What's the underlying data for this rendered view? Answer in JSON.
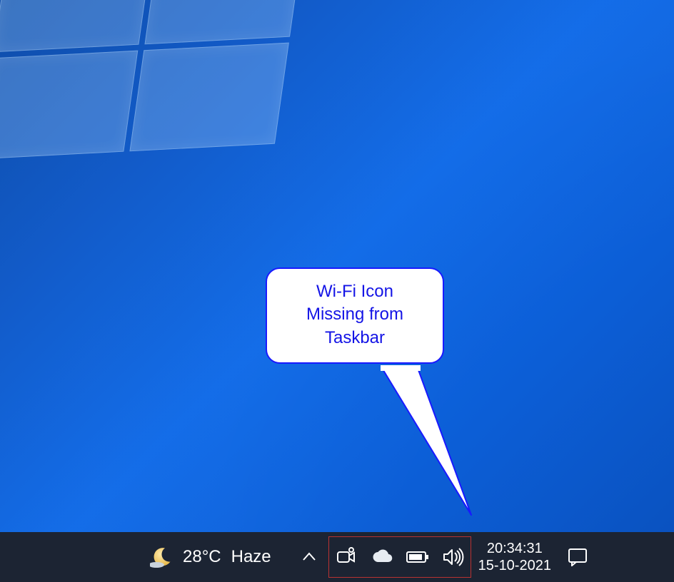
{
  "callout": {
    "line1": "Wi-Fi Icon",
    "line2": "Missing from",
    "line3": "Taskbar"
  },
  "weather": {
    "temp": "28°C",
    "condition": "Haze"
  },
  "datetime": {
    "time": "20:34:31",
    "date": "15-10-2021"
  },
  "colors": {
    "callout_border": "#1919ff",
    "callout_text": "#1414e6",
    "highlight_box": "#b93232",
    "taskbar_bg": "#1c2433"
  },
  "tray_icons": [
    "meet-now",
    "onedrive-cloud",
    "battery",
    "volume"
  ]
}
